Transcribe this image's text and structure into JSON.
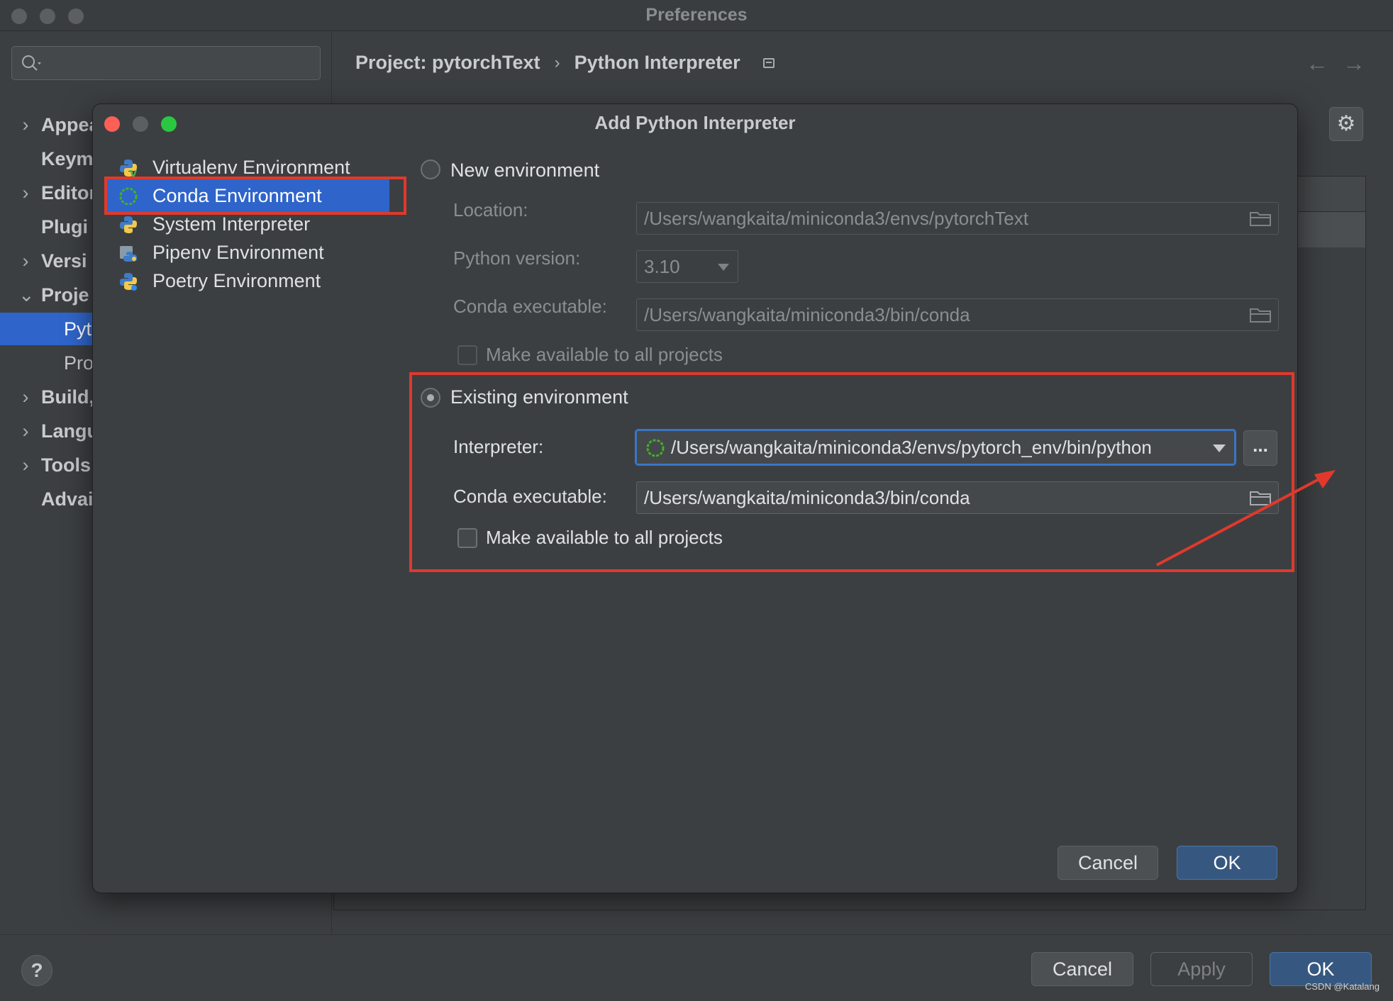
{
  "window": {
    "title": "Preferences"
  },
  "sidebar": {
    "items": [
      {
        "label": "Appea",
        "expandable": true
      },
      {
        "label": "Keym",
        "expandable": false
      },
      {
        "label": "Editor",
        "expandable": true
      },
      {
        "label": "Plugi",
        "expandable": false
      },
      {
        "label": "Versi",
        "expandable": true
      },
      {
        "label": "Proje",
        "expandable": true,
        "expanded": true
      },
      {
        "label": "Pyt",
        "sub": true,
        "selected": true
      },
      {
        "label": "Pro",
        "sub": true
      },
      {
        "label": "Build,",
        "expandable": true
      },
      {
        "label": "Langu",
        "expandable": true
      },
      {
        "label": "Tools",
        "expandable": true
      },
      {
        "label": "Advai",
        "expandable": false
      }
    ]
  },
  "breadcrumb": {
    "project": "Project: pytorchText",
    "separator": "›",
    "page": "Python Interpreter"
  },
  "footer": {
    "help": "?",
    "cancel": "Cancel",
    "apply": "Apply",
    "ok": "OK",
    "watermark": "CSDN @Katalang"
  },
  "dialog": {
    "title": "Add Python Interpreter",
    "env_types": [
      {
        "label": "Virtualenv Environment",
        "icon": "virtualenv-icon"
      },
      {
        "label": "Conda Environment",
        "icon": "conda-icon",
        "selected": true
      },
      {
        "label": "System Interpreter",
        "icon": "python-icon"
      },
      {
        "label": "Pipenv Environment",
        "icon": "pipenv-icon"
      },
      {
        "label": "Poetry Environment",
        "icon": "poetry-icon"
      }
    ],
    "new_env": {
      "radio_label": "New environment",
      "selected": false,
      "location_label": "Location:",
      "location_value": "/Users/wangkaita/miniconda3/envs/pytorchText",
      "python_version_label": "Python version:",
      "python_version_value": "3.10",
      "conda_exec_label": "Conda executable:",
      "conda_exec_value": "/Users/wangkaita/miniconda3/bin/conda",
      "make_available_label": "Make available to all projects"
    },
    "existing_env": {
      "radio_label": "Existing environment",
      "selected": true,
      "interpreter_label": "Interpreter:",
      "interpreter_value": "/Users/wangkaita/miniconda3/envs/pytorch_env/bin/python",
      "browse_label": "...",
      "conda_exec_label": "Conda executable:",
      "conda_exec_value": "/Users/wangkaita/miniconda3/bin/conda",
      "make_available_label": "Make available to all projects"
    },
    "buttons": {
      "cancel": "Cancel",
      "ok": "OK"
    }
  },
  "colors": {
    "selection": "#2f65ca",
    "annotation": "#e0392c",
    "focus_border": "#3a75c4"
  }
}
